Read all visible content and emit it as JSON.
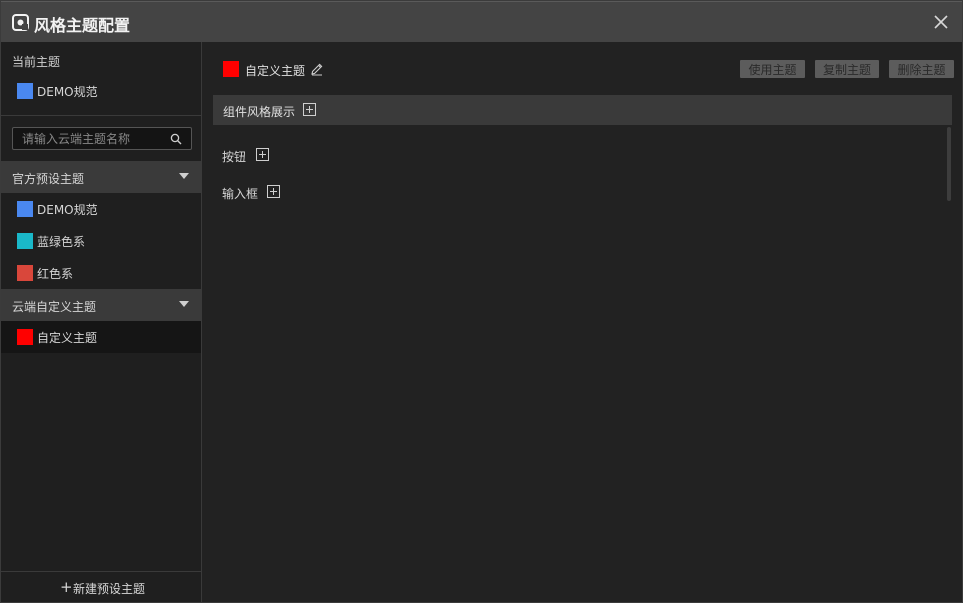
{
  "window": {
    "title": "风格主题配置",
    "icons": {
      "app": "theme-app-icon",
      "close": "close-icon"
    }
  },
  "sidebar": {
    "current_section_label": "当前主题",
    "current_theme": {
      "name": "DEMO规范",
      "color": "#4a88f0"
    },
    "search": {
      "placeholder": "请输入云端主题名称",
      "value": "",
      "icon": "search-icon"
    },
    "groups": [
      {
        "label": "官方预设主题",
        "expanded": true,
        "items": [
          {
            "name": "DEMO规范",
            "color": "#4a88f0"
          },
          {
            "name": "蓝绿色系",
            "color": "#1ab8c9"
          },
          {
            "name": "红色系",
            "color": "#d9473b"
          }
        ]
      },
      {
        "label": "云端自定义主题",
        "expanded": true,
        "items": [
          {
            "name": "自定义主题",
            "color": "#ff0000",
            "selected": true
          }
        ]
      }
    ],
    "new_preset": {
      "icon": "+",
      "label": "新建预设主题"
    }
  },
  "main": {
    "theme": {
      "name": "自定义主题",
      "color": "#ff0000",
      "edit_icon": "pencil-icon"
    },
    "actions": {
      "use": "使用主题",
      "copy": "复制主题",
      "delete": "删除主题"
    },
    "showcase": {
      "label": "组件风格展示",
      "components": [
        "按钮",
        "输入框"
      ]
    }
  },
  "colors": {
    "titlebar": "#444444",
    "panel": "#222222",
    "group_header": "#3a3a3a",
    "button": "#5c5c5c"
  }
}
